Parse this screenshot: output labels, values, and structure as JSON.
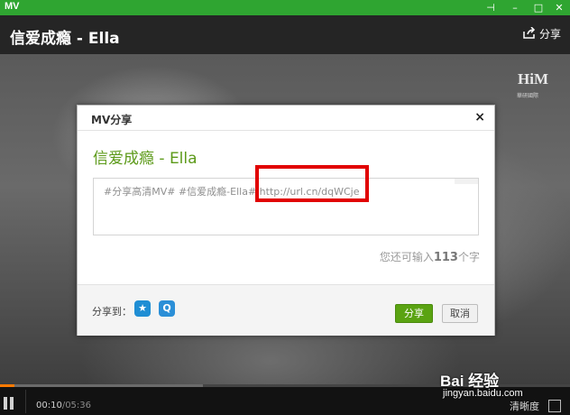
{
  "app": {
    "logo": "MV"
  },
  "window_controls": {
    "pin": "⊣",
    "minimize": "–",
    "maximize": "□",
    "close": "✕"
  },
  "header": {
    "title": "信爱成瘾 - Ella",
    "share_label": "分享"
  },
  "watermark": {
    "brand": "HiM",
    "sub": "華研國際"
  },
  "dialog": {
    "title": "MV分享",
    "close_symbol": "×",
    "song_title": "信爱成瘾 - Ella",
    "share_text": "#分享高清MV# #信爱成瘾-Ella#",
    "share_url": "http://url.cn/dqWCje",
    "remaining_prefix": "您还可输入",
    "remaining_count": "113",
    "remaining_suffix": "个字",
    "share_to_label": "分享到：",
    "share_button": "分享",
    "cancel_button": "取消"
  },
  "player": {
    "current_time": "00:10",
    "total_time": "/05:36",
    "quality_label": "清晰度"
  },
  "baidu": {
    "brand": "Bai 经验",
    "url": "jingyan.baidu.com"
  },
  "colors": {
    "accent_green": "#2fa531",
    "song_title": "#5c9a19",
    "highlight_box": "#e10000"
  }
}
